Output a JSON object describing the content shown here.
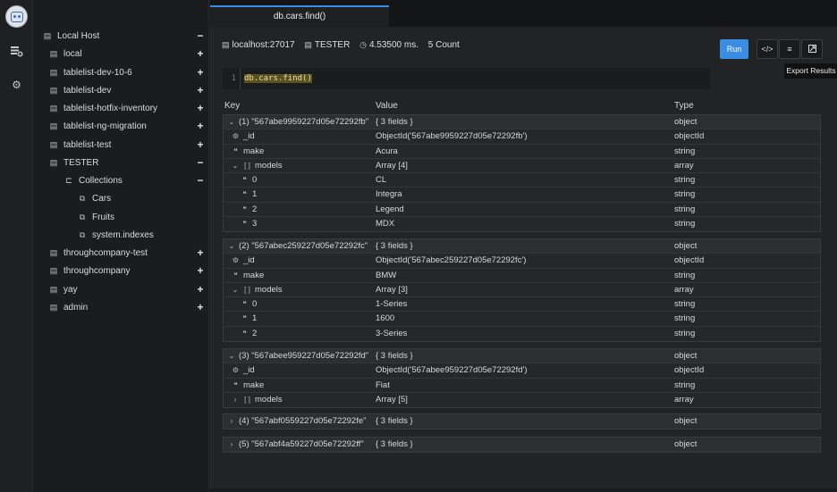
{
  "sidebar": {
    "root": {
      "label": "Local Host",
      "ctl": "−"
    },
    "databases": [
      {
        "label": "local",
        "ctl": "+"
      },
      {
        "label": "tablelist-dev-10-6",
        "ctl": "+"
      },
      {
        "label": "tablelist-dev",
        "ctl": "+"
      },
      {
        "label": "tablelist-hotfix-inventory",
        "ctl": "+"
      },
      {
        "label": "tablelist-ng-migration",
        "ctl": "+"
      },
      {
        "label": "tablelist-test",
        "ctl": "+"
      },
      {
        "label": "TESTER",
        "ctl": "−"
      }
    ],
    "collections_group": {
      "label": "Collections",
      "ctl": "−"
    },
    "collections": [
      {
        "label": "Cars"
      },
      {
        "label": "Fruits"
      },
      {
        "label": "system.indexes"
      }
    ],
    "databases_after": [
      {
        "label": "throughcompany-test",
        "ctl": "+"
      },
      {
        "label": "throughcompany",
        "ctl": "+"
      },
      {
        "label": "yay",
        "ctl": "+"
      },
      {
        "label": "admin",
        "ctl": "+"
      }
    ]
  },
  "tab": {
    "title": "db.cars.find()"
  },
  "connection": {
    "host": "localhost:27017",
    "database": "TESTER",
    "time": "4.53500 ms.",
    "count": "5 Count"
  },
  "toolbar": {
    "run_label": "Run",
    "tooltip": "Export Results"
  },
  "editor": {
    "line_number": "1",
    "query": "db.cars.find()"
  },
  "results": {
    "headers": {
      "key": "Key",
      "value": "Value",
      "type": "Type"
    },
    "documents": [
      {
        "key": "(1) \"567abe9959227d05e72292fb\"",
        "value": "{ 3 fields }",
        "type": "object",
        "expanded": true,
        "fields": [
          {
            "key": "_id",
            "icon": "gear",
            "value": "ObjectId('567abe9959227d05e72292fb')",
            "type": "objectId",
            "level": 1
          },
          {
            "key": "make",
            "icon": "quote",
            "value": "Acura",
            "type": "string",
            "level": 1
          },
          {
            "key": "models",
            "icon": "array",
            "value": "Array [4]",
            "type": "array",
            "level": 1,
            "toggle": "open"
          },
          {
            "key": "0",
            "icon": "quote",
            "value": "CL",
            "type": "string",
            "level": 2
          },
          {
            "key": "1",
            "icon": "quote",
            "value": "Integra",
            "type": "string",
            "level": 2
          },
          {
            "key": "2",
            "icon": "quote",
            "value": "Legend",
            "type": "string",
            "level": 2
          },
          {
            "key": "3",
            "icon": "quote",
            "value": "MDX",
            "type": "string",
            "level": 2
          }
        ]
      },
      {
        "key": "(2) \"567abec259227d05e72292fc\"",
        "value": "{ 3 fields }",
        "type": "object",
        "expanded": true,
        "fields": [
          {
            "key": "_id",
            "icon": "gear",
            "value": "ObjectId('567abec259227d05e72292fc')",
            "type": "objectId",
            "level": 1
          },
          {
            "key": "make",
            "icon": "quote",
            "value": "BMW",
            "type": "string",
            "level": 1
          },
          {
            "key": "models",
            "icon": "array",
            "value": "Array [3]",
            "type": "array",
            "level": 1,
            "toggle": "open"
          },
          {
            "key": "0",
            "icon": "quote",
            "value": "1-Series",
            "type": "string",
            "level": 2
          },
          {
            "key": "1",
            "icon": "quote",
            "value": "1600",
            "type": "string",
            "level": 2
          },
          {
            "key": "2",
            "icon": "quote",
            "value": "3-Series",
            "type": "string",
            "level": 2
          }
        ]
      },
      {
        "key": "(3) \"567abee959227d05e72292fd\"",
        "value": "{ 3 fields }",
        "type": "object",
        "expanded": true,
        "fields": [
          {
            "key": "_id",
            "icon": "gear",
            "value": "ObjectId('567abee959227d05e72292fd')",
            "type": "objectId",
            "level": 1
          },
          {
            "key": "make",
            "icon": "quote",
            "value": "Fiat",
            "type": "string",
            "level": 1
          },
          {
            "key": "models",
            "icon": "array",
            "value": "Array [5]",
            "type": "array",
            "level": 1,
            "toggle": "closed"
          }
        ]
      },
      {
        "key": "(4) \"567abf0559227d05e72292fe\"",
        "value": "{ 3 fields }",
        "type": "object",
        "expanded": false,
        "fields": []
      },
      {
        "key": "(5) \"567abf4a59227d05e72292ff\"",
        "value": "{ 3 fields }",
        "type": "object",
        "expanded": false,
        "fields": []
      }
    ]
  }
}
